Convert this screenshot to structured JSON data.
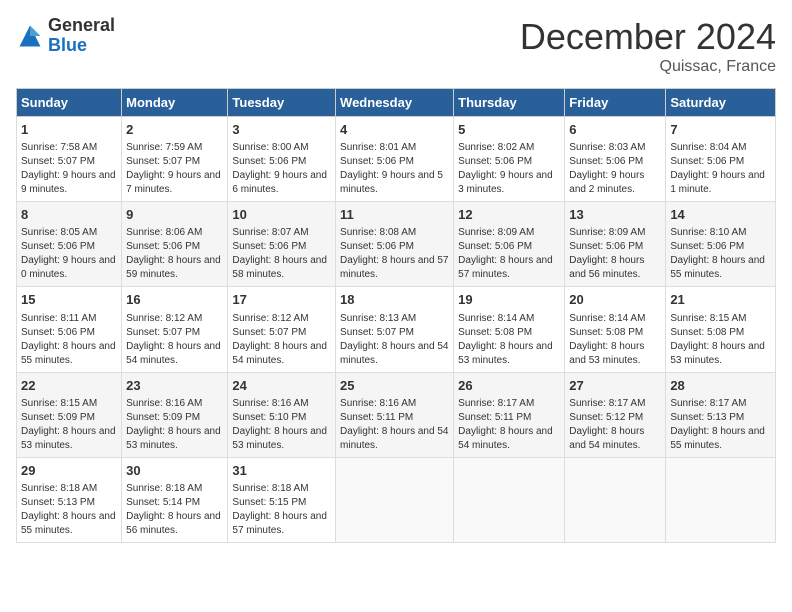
{
  "header": {
    "logo_general": "General",
    "logo_blue": "Blue",
    "month_title": "December 2024",
    "location": "Quissac, France"
  },
  "days_of_week": [
    "Sunday",
    "Monday",
    "Tuesday",
    "Wednesday",
    "Thursday",
    "Friday",
    "Saturday"
  ],
  "weeks": [
    [
      {
        "day": 1,
        "sunrise": "Sunrise: 7:58 AM",
        "sunset": "Sunset: 5:07 PM",
        "daylight": "Daylight: 9 hours and 9 minutes."
      },
      {
        "day": 2,
        "sunrise": "Sunrise: 7:59 AM",
        "sunset": "Sunset: 5:07 PM",
        "daylight": "Daylight: 9 hours and 7 minutes."
      },
      {
        "day": 3,
        "sunrise": "Sunrise: 8:00 AM",
        "sunset": "Sunset: 5:06 PM",
        "daylight": "Daylight: 9 hours and 6 minutes."
      },
      {
        "day": 4,
        "sunrise": "Sunrise: 8:01 AM",
        "sunset": "Sunset: 5:06 PM",
        "daylight": "Daylight: 9 hours and 5 minutes."
      },
      {
        "day": 5,
        "sunrise": "Sunrise: 8:02 AM",
        "sunset": "Sunset: 5:06 PM",
        "daylight": "Daylight: 9 hours and 3 minutes."
      },
      {
        "day": 6,
        "sunrise": "Sunrise: 8:03 AM",
        "sunset": "Sunset: 5:06 PM",
        "daylight": "Daylight: 9 hours and 2 minutes."
      },
      {
        "day": 7,
        "sunrise": "Sunrise: 8:04 AM",
        "sunset": "Sunset: 5:06 PM",
        "daylight": "Daylight: 9 hours and 1 minute."
      }
    ],
    [
      {
        "day": 8,
        "sunrise": "Sunrise: 8:05 AM",
        "sunset": "Sunset: 5:06 PM",
        "daylight": "Daylight: 9 hours and 0 minutes."
      },
      {
        "day": 9,
        "sunrise": "Sunrise: 8:06 AM",
        "sunset": "Sunset: 5:06 PM",
        "daylight": "Daylight: 8 hours and 59 minutes."
      },
      {
        "day": 10,
        "sunrise": "Sunrise: 8:07 AM",
        "sunset": "Sunset: 5:06 PM",
        "daylight": "Daylight: 8 hours and 58 minutes."
      },
      {
        "day": 11,
        "sunrise": "Sunrise: 8:08 AM",
        "sunset": "Sunset: 5:06 PM",
        "daylight": "Daylight: 8 hours and 57 minutes."
      },
      {
        "day": 12,
        "sunrise": "Sunrise: 8:09 AM",
        "sunset": "Sunset: 5:06 PM",
        "daylight": "Daylight: 8 hours and 57 minutes."
      },
      {
        "day": 13,
        "sunrise": "Sunrise: 8:09 AM",
        "sunset": "Sunset: 5:06 PM",
        "daylight": "Daylight: 8 hours and 56 minutes."
      },
      {
        "day": 14,
        "sunrise": "Sunrise: 8:10 AM",
        "sunset": "Sunset: 5:06 PM",
        "daylight": "Daylight: 8 hours and 55 minutes."
      }
    ],
    [
      {
        "day": 15,
        "sunrise": "Sunrise: 8:11 AM",
        "sunset": "Sunset: 5:06 PM",
        "daylight": "Daylight: 8 hours and 55 minutes."
      },
      {
        "day": 16,
        "sunrise": "Sunrise: 8:12 AM",
        "sunset": "Sunset: 5:07 PM",
        "daylight": "Daylight: 8 hours and 54 minutes."
      },
      {
        "day": 17,
        "sunrise": "Sunrise: 8:12 AM",
        "sunset": "Sunset: 5:07 PM",
        "daylight": "Daylight: 8 hours and 54 minutes."
      },
      {
        "day": 18,
        "sunrise": "Sunrise: 8:13 AM",
        "sunset": "Sunset: 5:07 PM",
        "daylight": "Daylight: 8 hours and 54 minutes."
      },
      {
        "day": 19,
        "sunrise": "Sunrise: 8:14 AM",
        "sunset": "Sunset: 5:08 PM",
        "daylight": "Daylight: 8 hours and 53 minutes."
      },
      {
        "day": 20,
        "sunrise": "Sunrise: 8:14 AM",
        "sunset": "Sunset: 5:08 PM",
        "daylight": "Daylight: 8 hours and 53 minutes."
      },
      {
        "day": 21,
        "sunrise": "Sunrise: 8:15 AM",
        "sunset": "Sunset: 5:08 PM",
        "daylight": "Daylight: 8 hours and 53 minutes."
      }
    ],
    [
      {
        "day": 22,
        "sunrise": "Sunrise: 8:15 AM",
        "sunset": "Sunset: 5:09 PM",
        "daylight": "Daylight: 8 hours and 53 minutes."
      },
      {
        "day": 23,
        "sunrise": "Sunrise: 8:16 AM",
        "sunset": "Sunset: 5:09 PM",
        "daylight": "Daylight: 8 hours and 53 minutes."
      },
      {
        "day": 24,
        "sunrise": "Sunrise: 8:16 AM",
        "sunset": "Sunset: 5:10 PM",
        "daylight": "Daylight: 8 hours and 53 minutes."
      },
      {
        "day": 25,
        "sunrise": "Sunrise: 8:16 AM",
        "sunset": "Sunset: 5:11 PM",
        "daylight": "Daylight: 8 hours and 54 minutes."
      },
      {
        "day": 26,
        "sunrise": "Sunrise: 8:17 AM",
        "sunset": "Sunset: 5:11 PM",
        "daylight": "Daylight: 8 hours and 54 minutes."
      },
      {
        "day": 27,
        "sunrise": "Sunrise: 8:17 AM",
        "sunset": "Sunset: 5:12 PM",
        "daylight": "Daylight: 8 hours and 54 minutes."
      },
      {
        "day": 28,
        "sunrise": "Sunrise: 8:17 AM",
        "sunset": "Sunset: 5:13 PM",
        "daylight": "Daylight: 8 hours and 55 minutes."
      }
    ],
    [
      {
        "day": 29,
        "sunrise": "Sunrise: 8:18 AM",
        "sunset": "Sunset: 5:13 PM",
        "daylight": "Daylight: 8 hours and 55 minutes."
      },
      {
        "day": 30,
        "sunrise": "Sunrise: 8:18 AM",
        "sunset": "Sunset: 5:14 PM",
        "daylight": "Daylight: 8 hours and 56 minutes."
      },
      {
        "day": 31,
        "sunrise": "Sunrise: 8:18 AM",
        "sunset": "Sunset: 5:15 PM",
        "daylight": "Daylight: 8 hours and 57 minutes."
      },
      null,
      null,
      null,
      null
    ]
  ]
}
